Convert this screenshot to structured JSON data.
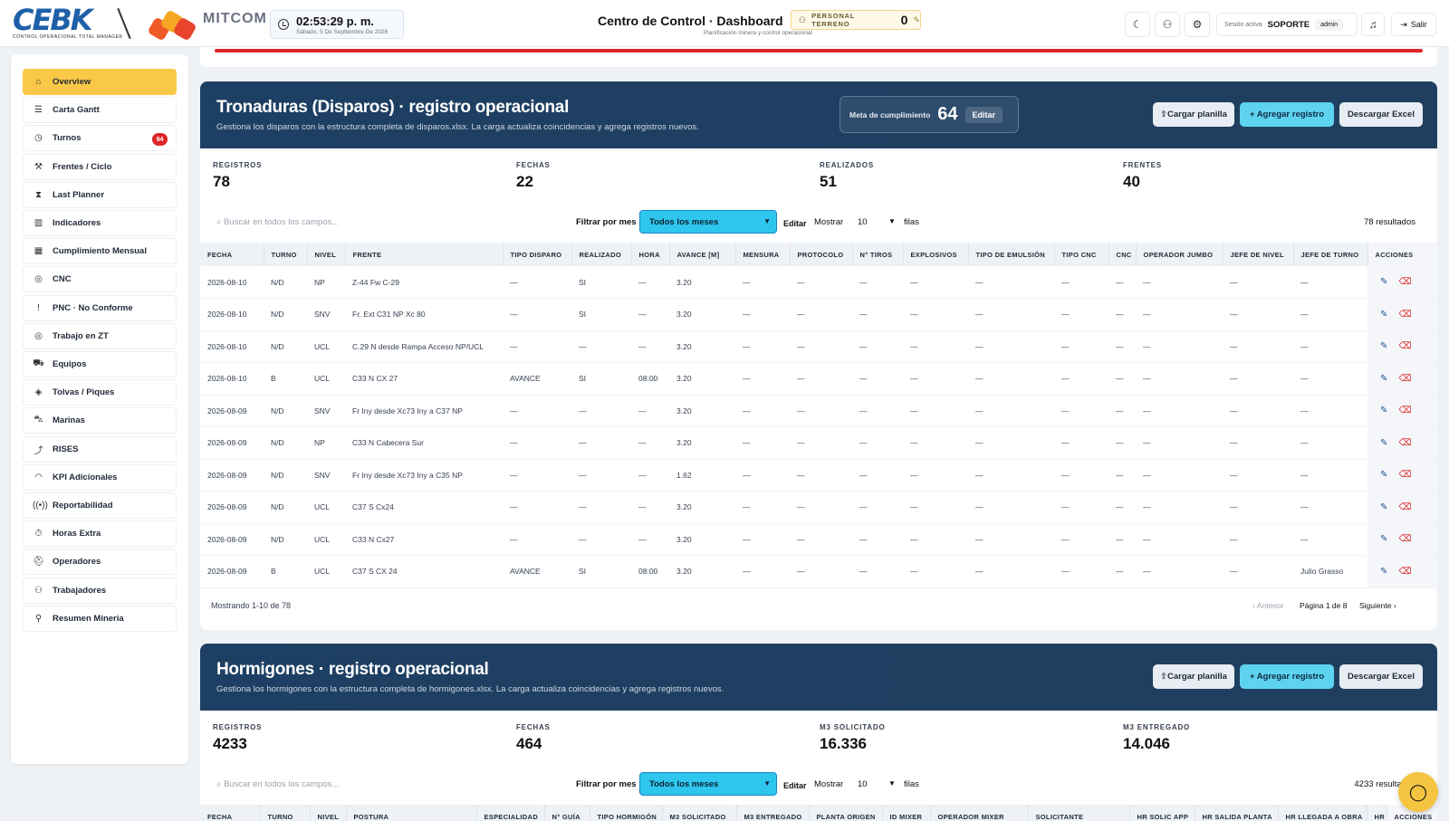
{
  "brand": {
    "logo1": "CEBK",
    "logo1_sub": "CONTROL OPERACIONAL TOTAL MANAGER",
    "logo2": "MITCOM"
  },
  "clock": {
    "time": "02:53:29 p. m.",
    "date": "Sábado, 5 De Septiembre De 2026"
  },
  "header": {
    "title": "Centro de Control · Dashboard",
    "subtitle": "Planificación minera y control operacional",
    "personal_label": "PERSONAL TERRENO",
    "personal_count": "0"
  },
  "session": {
    "label": "Sesión activa",
    "user": "SOPORTE",
    "role": "admin",
    "logout": "Salir"
  },
  "sidebar": {
    "items": [
      {
        "label": "Overview",
        "icon": "home-icon",
        "glyph": "⌂"
      },
      {
        "label": "Carta Gantt",
        "icon": "gantt-icon",
        "glyph": "☰"
      },
      {
        "label": "Turnos",
        "icon": "clock-icon",
        "glyph": "◷",
        "badge": "94"
      },
      {
        "label": "Frentes / Ciclo",
        "icon": "pickaxe-icon",
        "glyph": "⚒"
      },
      {
        "label": "Last Planner",
        "icon": "hourglass-icon",
        "glyph": "⧗"
      },
      {
        "label": "Indicadores",
        "icon": "bar-chart-icon",
        "glyph": "▥"
      },
      {
        "label": "Cumplimiento Mensual",
        "icon": "calendar-icon",
        "glyph": "▦"
      },
      {
        "label": "CNC",
        "icon": "compass-icon",
        "glyph": "◎"
      },
      {
        "label": "PNC · No Conforme",
        "icon": "alert-file-icon",
        "glyph": "!"
      },
      {
        "label": "Trabajo en ZT",
        "icon": "compass-icon",
        "glyph": "◎"
      },
      {
        "label": "Equipos",
        "icon": "truck-icon",
        "glyph": "⛟"
      },
      {
        "label": "Tolvas / Piques",
        "icon": "box-icon",
        "glyph": "◈"
      },
      {
        "label": "Marinas",
        "icon": "loader-icon",
        "glyph": "⛍"
      },
      {
        "label": "RISES",
        "icon": "rise-icon",
        "glyph": "⤴"
      },
      {
        "label": "KPI Adicionales",
        "icon": "gauge-icon",
        "glyph": "◠"
      },
      {
        "label": "Reportabilidad",
        "icon": "radio-icon",
        "glyph": "((•))"
      },
      {
        "label": "Horas Extra",
        "icon": "timer-icon",
        "glyph": "⏱"
      },
      {
        "label": "Operadores",
        "icon": "helmet-icon",
        "glyph": "⛑"
      },
      {
        "label": "Trabajadores",
        "icon": "users-icon",
        "glyph": "⚇"
      },
      {
        "label": "Resumen Mineria",
        "icon": "wrench-icon",
        "glyph": "⚲"
      }
    ]
  },
  "tron": {
    "title": "Tronaduras (Disparos) · registro operacional",
    "subtitle": "Gestiona los disparos con la estructura completa de disparos.xlsx. La carga actualiza coincidencias y agrega registros nuevos.",
    "meta_label": "Meta de cumplimiento",
    "meta_value": "64",
    "meta_edit": "Editar",
    "btn_upload": "⇧Cargar planilla",
    "btn_add": "+ Agregar registro",
    "btn_excel": "Descargar Excel",
    "stats": [
      {
        "label": "REGISTROS",
        "value": "78"
      },
      {
        "label": "FECHAS",
        "value": "22"
      },
      {
        "label": "REALIZADOS",
        "value": "51"
      },
      {
        "label": "FRENTES",
        "value": "40"
      }
    ],
    "search_placeholder": "Buscar en todos los campos...",
    "filter_label": "Filtrar por mes",
    "filter_value": "Todos los meses",
    "filter_edit": "Editar",
    "show_label": "Mostrar",
    "show_value": "10",
    "rows_label": "filas",
    "results": "78 resultados",
    "columns": [
      "FECHA",
      "TURNO",
      "NIVEL",
      "FRENTE",
      "TIPO DISPARO",
      "REALIZADO",
      "HORA",
      "AVANCE [M]",
      "MENSURA",
      "PROTOCOLO",
      "N° TIROS",
      "EXPLOSIVOS",
      "TIPO DE EMULSIÓN",
      "TIPO CNC",
      "CNC",
      "OPERADOR JUMBO",
      "JEFE DE NIVEL",
      "JEFE DE TURNO",
      "ACCIONES"
    ],
    "rows": [
      [
        "2026-08-10",
        "N/D",
        "NP",
        "Z-44 Fw C-29",
        "—",
        "SI",
        "—",
        "3.20",
        "—",
        "—",
        "—",
        "—",
        "—",
        "—",
        "—",
        "—",
        "—",
        "—"
      ],
      [
        "2026-08-10",
        "N/D",
        "SNV",
        "Fr. Ext C31 NP Xc 80",
        "—",
        "SI",
        "—",
        "3.20",
        "—",
        "—",
        "—",
        "—",
        "—",
        "—",
        "—",
        "—",
        "—",
        "—"
      ],
      [
        "2026-08-10",
        "N/D",
        "UCL",
        "C.29 N desde Rampa Acceso NP/UCL",
        "—",
        "—",
        "—",
        "3.20",
        "—",
        "—",
        "—",
        "—",
        "—",
        "—",
        "—",
        "—",
        "—",
        "—"
      ],
      [
        "2026-08-10",
        "B",
        "UCL",
        "C33 N CX 27",
        "AVANCE",
        "SI",
        "08:00",
        "3.20",
        "—",
        "—",
        "—",
        "—",
        "—",
        "—",
        "—",
        "—",
        "—",
        "—"
      ],
      [
        "2026-08-09",
        "N/D",
        "SNV",
        "Fr Iny desde Xc73 Iny a C37 NP",
        "—",
        "—",
        "—",
        "3.20",
        "—",
        "—",
        "—",
        "—",
        "—",
        "—",
        "—",
        "—",
        "—",
        "—"
      ],
      [
        "2026-08-09",
        "N/D",
        "NP",
        "C33 N Cabecera Sur",
        "—",
        "—",
        "—",
        "3.20",
        "—",
        "—",
        "—",
        "—",
        "—",
        "—",
        "—",
        "—",
        "—",
        "—"
      ],
      [
        "2026-08-09",
        "N/D",
        "SNV",
        "Fr Iny desde Xc73 Iny a C35 NP",
        "—",
        "—",
        "—",
        "1.62",
        "—",
        "—",
        "—",
        "—",
        "—",
        "—",
        "—",
        "—",
        "—",
        "—"
      ],
      [
        "2026-08-09",
        "N/D",
        "UCL",
        "C37 S Cx24",
        "—",
        "—",
        "—",
        "3.20",
        "—",
        "—",
        "—",
        "—",
        "—",
        "—",
        "—",
        "—",
        "—",
        "—"
      ],
      [
        "2026-08-09",
        "N/D",
        "UCL",
        "C33 N Cx27",
        "—",
        "—",
        "—",
        "3.20",
        "—",
        "—",
        "—",
        "—",
        "—",
        "—",
        "—",
        "—",
        "—",
        "—"
      ],
      [
        "2026-08-09",
        "B",
        "UCL",
        "C37 S CX 24",
        "AVANCE",
        "SI",
        "08:00",
        "3.20",
        "—",
        "—",
        "—",
        "—",
        "—",
        "—",
        "—",
        "—",
        "—",
        "Julio Grasso"
      ]
    ],
    "showing": "Mostrando 1-10 de 78",
    "prev": "‹ Anterior",
    "page": "Página 1 de 8",
    "next": "Siguiente ›"
  },
  "horm": {
    "title": "Hormigones · registro operacional",
    "subtitle": "Gestiona los hormigones con la estructura completa de hormigones.xlsx. La carga actualiza coincidencias y agrega registros nuevos.",
    "btn_upload": "⇧Cargar planilla",
    "btn_add": "+ Agregar registro",
    "btn_excel": "Descargar Excel",
    "stats": [
      {
        "label": "REGISTROS",
        "value": "4233"
      },
      {
        "label": "FECHAS",
        "value": "464"
      },
      {
        "label": "M3 SOLICITADO",
        "value": "16.336"
      },
      {
        "label": "M3 ENTREGADO",
        "value": "14.046"
      }
    ],
    "search_placeholder": "Buscar en todos los campos...",
    "filter_label": "Filtrar por mes",
    "filter_value": "Todos los meses",
    "filter_edit": "Editar",
    "show_label": "Mostrar",
    "show_value": "10",
    "rows_label": "filas",
    "results": "4233 resultados",
    "columns": [
      "FECHA",
      "TURNO",
      "NIVEL",
      "POSTURA",
      "ESPECIALIDAD",
      "N° GUÍA",
      "TIPO HORMIGÓN",
      "M3 SOLICITADO",
      "M3 ENTREGADO",
      "PLANTA ORIGEN",
      "ID MIXER",
      "OPERADOR MIXER",
      "SOLICITANTE",
      "HR SOLIC APP",
      "HR SALIDA PLANTA",
      "HR LLEGADA A OBRA",
      "HR",
      "ACCIONES"
    ]
  }
}
